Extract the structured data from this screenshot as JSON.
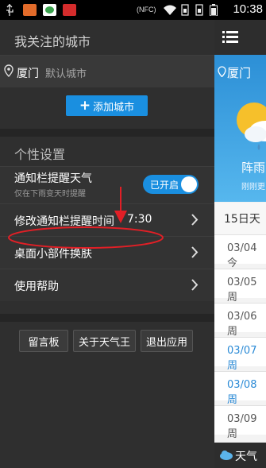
{
  "status_bar": {
    "nfc": "(NFC)",
    "time": "10:38",
    "icons": [
      "usb-icon",
      "app-icon",
      "app-icon",
      "app-icon",
      "nfc-icon",
      "wifi-icon",
      "sim-icon",
      "sim-icon",
      "battery-icon"
    ]
  },
  "drawer": {
    "city_section_title": "我关注的城市",
    "city": {
      "name": "厦门",
      "tag": "默认城市"
    },
    "add_city_label": "添加城市",
    "settings_title": "个性设置",
    "notify": {
      "label": "通知栏提醒天气",
      "sub": "仅在下雨变天时提醒",
      "toggle_label": "已开启",
      "enabled": true
    },
    "menu": [
      {
        "label": "修改通知栏提醒时间",
        "value": "7:30"
      },
      {
        "label": "桌面小部件换肤"
      },
      {
        "label": "使用帮助"
      }
    ],
    "bottom_buttons": [
      "留言板",
      "关于天气王",
      "退出应用"
    ]
  },
  "main": {
    "city": "厦门",
    "condition": "阵雨",
    "update_text": "刚刚更",
    "forecast_title": "15日天",
    "forecast": [
      {
        "date": "03/04今",
        "color": "#555555"
      },
      {
        "date": "03/05周",
        "color": "#555555"
      },
      {
        "date": "03/06周",
        "color": "#555555"
      },
      {
        "date": "03/07周",
        "color": "#2a8ad6"
      },
      {
        "date": "03/08周",
        "color": "#2a8ad6"
      },
      {
        "date": "03/09周",
        "color": "#555555"
      }
    ],
    "footer_label": "天气"
  },
  "colors": {
    "accent": "#1a8fe0",
    "annotation": "#e21f26"
  }
}
